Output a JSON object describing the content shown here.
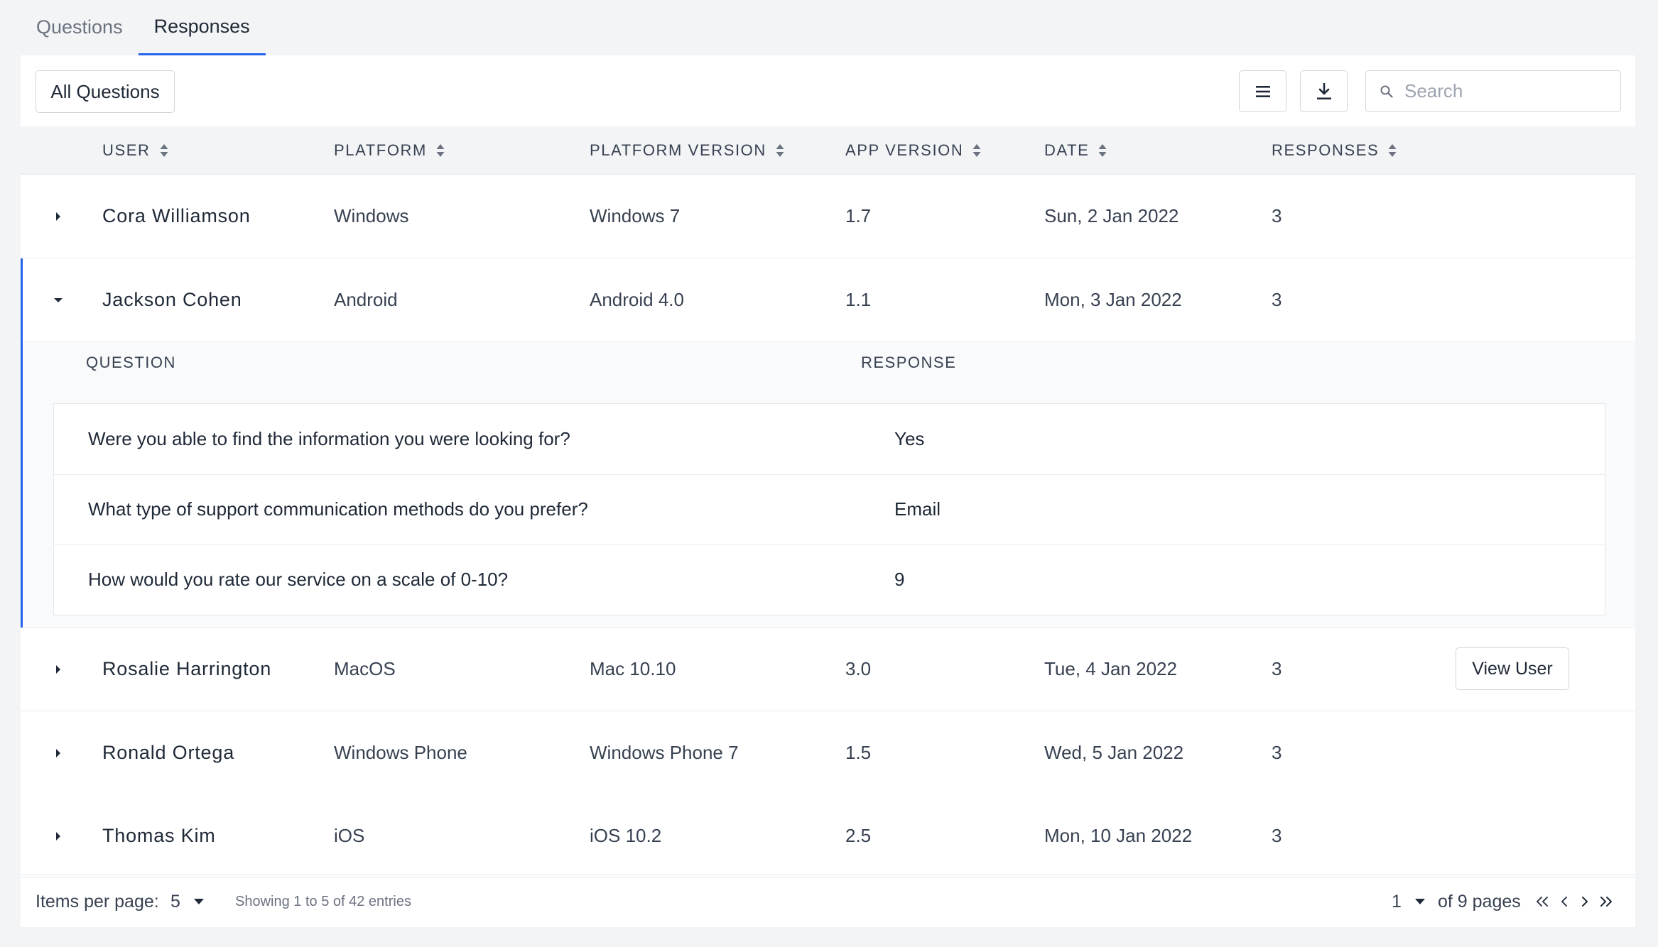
{
  "tabs": [
    {
      "label": "Questions",
      "active": false
    },
    {
      "label": "Responses",
      "active": true
    }
  ],
  "toolbar": {
    "filter_label": "All Questions",
    "menu_icon": "menu-icon",
    "download_icon": "download-icon",
    "search_placeholder": "Search",
    "search_value": ""
  },
  "columns": [
    "USER",
    "PLATFORM",
    "PLATFORM VERSION",
    "APP VERSION",
    "DATE",
    "RESPONSES"
  ],
  "rows": [
    {
      "user": "Cora Williamson",
      "platform": "Windows",
      "platform_version": "Windows 7",
      "app_version": "1.7",
      "date": "Sun, 2 Jan 2022",
      "responses": "3",
      "expanded": false
    },
    {
      "user": "Jackson Cohen",
      "platform": "Android",
      "platform_version": "Android 4.0",
      "app_version": "1.1",
      "date": "Mon, 3 Jan 2022",
      "responses": "3",
      "expanded": true
    },
    {
      "user": "Rosalie Harrington",
      "platform": "MacOS",
      "platform_version": "Mac 10.10",
      "app_version": "3.0",
      "date": "Tue, 4 Jan 2022",
      "responses": "3",
      "expanded": false,
      "action": "View User"
    },
    {
      "user": "Ronald Ortega",
      "platform": "Windows Phone",
      "platform_version": "Windows Phone 7",
      "app_version": "1.5",
      "date": "Wed, 5 Jan 2022",
      "responses": "3",
      "expanded": false
    },
    {
      "user": "Thomas Kim",
      "platform": "iOS",
      "platform_version": "iOS 10.2",
      "app_version": "2.5",
      "date": "Mon, 10 Jan 2022",
      "responses": "3",
      "expanded": false
    }
  ],
  "detail": {
    "header_question": "QUESTION",
    "header_response": "RESPONSE",
    "items": [
      {
        "question": "Were you able to find the information you were looking for?",
        "response": "Yes"
      },
      {
        "question": "What type of support communication methods do you prefer?",
        "response": "Email"
      },
      {
        "question": "How would you rate our service on a scale of 0-10?",
        "response": "9"
      }
    ]
  },
  "footer": {
    "items_per_page_label": "Items per page:",
    "items_per_page_value": "5",
    "showing_text": "Showing 1 to 5 of 42 entries",
    "current_page": "1",
    "of_pages_text": "of 9 pages"
  },
  "colors": {
    "accent": "#2563eb",
    "background": "#f3f4f6",
    "surface": "#ffffff",
    "border": "#d1d5db"
  }
}
